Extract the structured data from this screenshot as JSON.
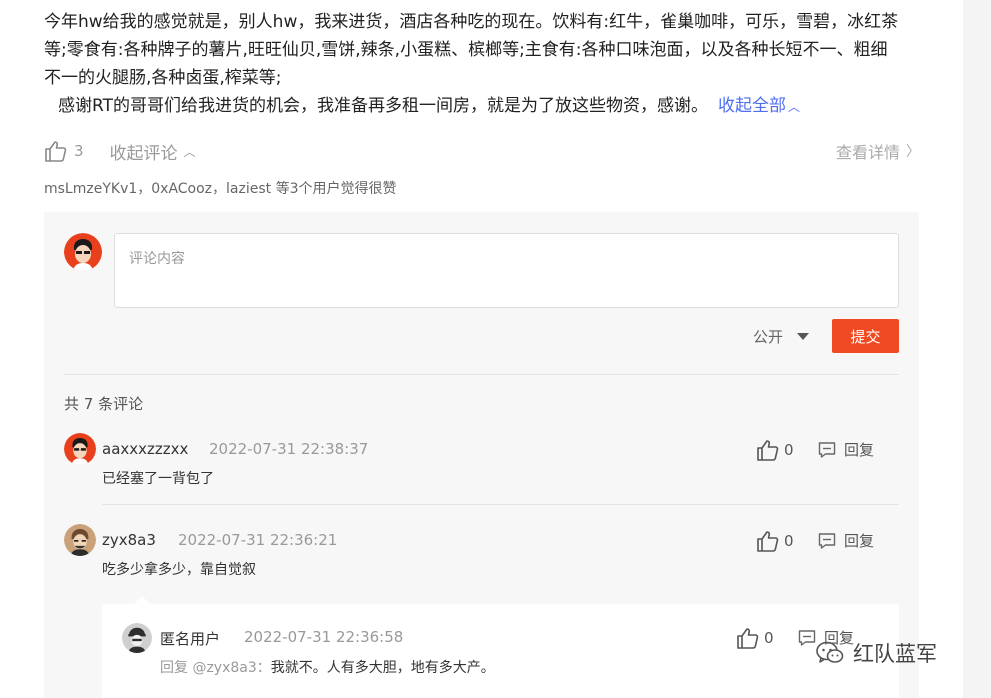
{
  "answer": {
    "line1": "今年hw给我的感觉就是，别人hw，我来进货，酒店各种吃的现在。饮料有:红牛，雀巢咖啡，可乐，雪碧，冰红茶",
    "line2": "等;零食有:各种牌子的薯片,旺旺仙贝,雪饼,辣条,小蛋糕、槟榔等;主食有:各种口味泡面，以及各种长短不一、粗细",
    "line3": "不一的火腿肠,各种卤蛋,榨菜等;",
    "line4": "感谢RT的哥哥们给我进货的机会，我准备再多租一间房，就是为了放这些物资，感谢。",
    "collapse_all": "收起全部"
  },
  "actions": {
    "like_count": "3",
    "collapse_comments": "收起评论",
    "view_detail": "查看详情"
  },
  "likers_text": "msLmzeYKv1，0xACooz，laziest 等3个用户觉得很赞",
  "comment_box": {
    "placeholder": "评论内容",
    "visibility": "公开",
    "submit": "提交"
  },
  "comments_count": "共 7 条评论",
  "comments": [
    {
      "name": "aaxxxzzzxx",
      "time": "2022-07-31 22:38:37",
      "text": "已经塞了一背包了",
      "likes": "0",
      "reply": "回复"
    },
    {
      "name": "zyx8a3",
      "time": "2022-07-31 22:36:21",
      "text": "吃多少拿多少，靠自觉叙",
      "likes": "0",
      "reply": "回复"
    }
  ],
  "nested_reply": {
    "name": "匿名用户",
    "time": "2022-07-31 22:36:58",
    "prefix": "回复 @zyx8a3：",
    "text": "我就不。人有多大胆，地有多大产。",
    "likes": "0",
    "reply": "回复"
  },
  "watermark": "红队蓝军",
  "colors": {
    "accent_blue": "#4e6ef2",
    "submit_red": "#f04a23"
  }
}
